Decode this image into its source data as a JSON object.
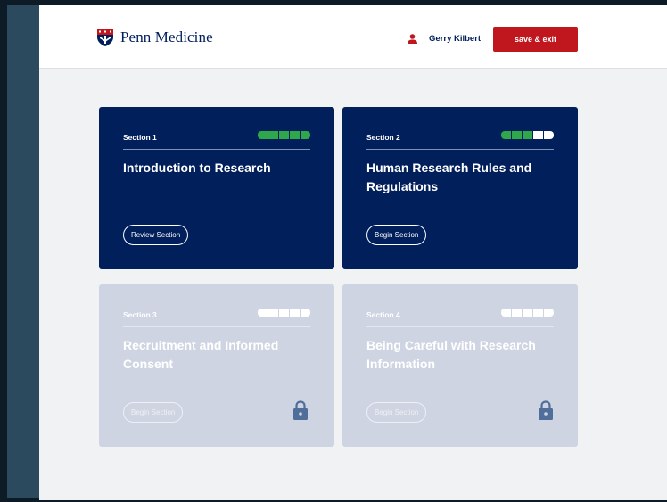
{
  "header": {
    "logo_text": "Penn Medicine",
    "user_name": "Gerry Kilbert",
    "save_label": "save & exit"
  },
  "colors": {
    "navy": "#011f5b",
    "red": "#c0161e",
    "green": "#2ea84a",
    "locked_card": "#ced4e2"
  },
  "sections": [
    {
      "label": "Section 1",
      "title": "Introduction to Research",
      "button": "Review Section",
      "progress_complete": 5,
      "progress_total": 5,
      "locked": false
    },
    {
      "label": "Section 2",
      "title": "Human Research Rules and Regulations",
      "button": "Begin Section",
      "progress_complete": 3,
      "progress_total": 5,
      "locked": false
    },
    {
      "label": "Section 3",
      "title": "Recruitment and Informed Consent",
      "button": "Begin Section",
      "progress_complete": 0,
      "progress_total": 5,
      "locked": true,
      "icon": "lock-icon"
    },
    {
      "label": "Section 4",
      "title": "Being Careful with Research Information",
      "button": "Begin Section",
      "progress_complete": 0,
      "progress_total": 5,
      "locked": true,
      "icon": "lock-icon"
    }
  ]
}
